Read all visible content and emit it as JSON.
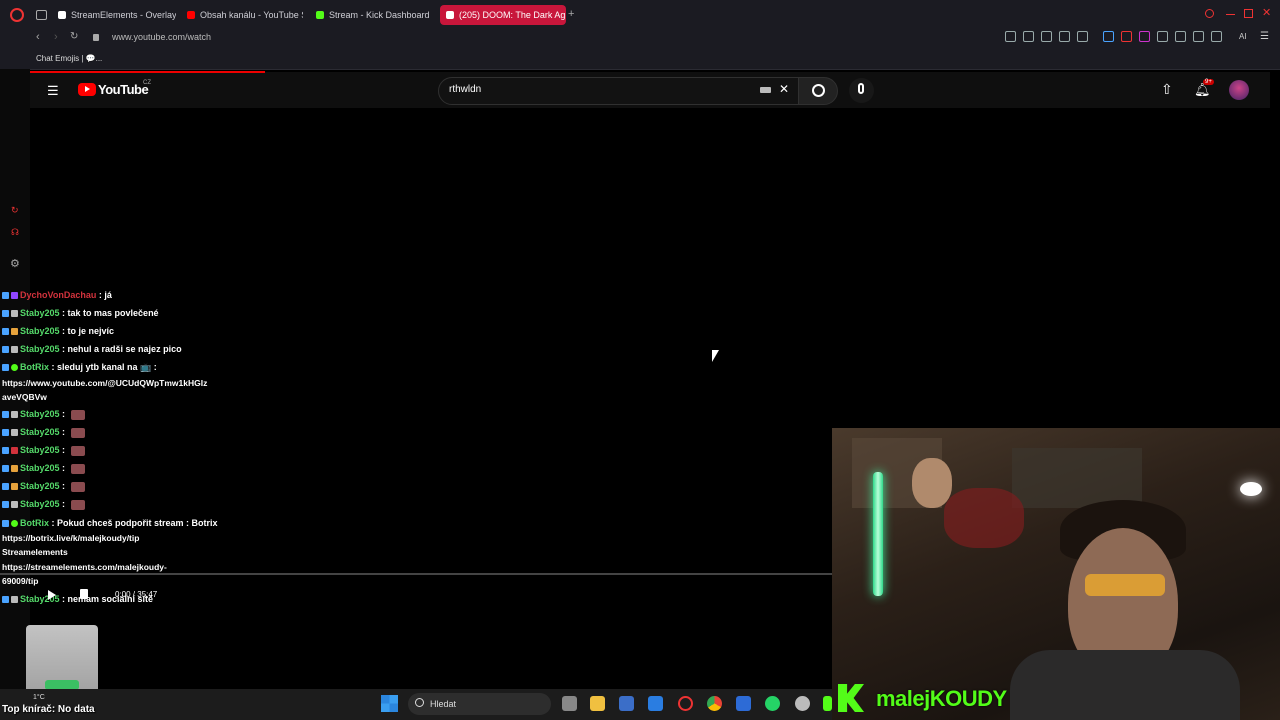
{
  "browser": {
    "tabs": [
      {
        "label": "StreamElements - Overlay",
        "color": "#ffffff"
      },
      {
        "label": "Obsah kanálu - YouTube S",
        "color": "#ff0000"
      },
      {
        "label": "Stream - Kick Dashboard",
        "color": "#53fc18"
      },
      {
        "label": "(205) DOOM: The Dark Ag",
        "color": "#ff0000"
      }
    ],
    "url": "www.youtube.com/watch",
    "bookmark": "Chat Emojis | 💬...",
    "ai_label": "AI"
  },
  "youtube": {
    "logo": "YouTube",
    "region": "CZ",
    "search_query": "rthwldn",
    "notification_count": "9+"
  },
  "chat": [
    {
      "user": "DychoVonDachau",
      "message": " : já",
      "color": "#d2323c"
    },
    {
      "user": "Staby205",
      "message": " : tak to mas povlečené",
      "color": "#55d96a"
    },
    {
      "user": "Staby205",
      "message": " : to je nejvíc",
      "color": "#55d96a"
    },
    {
      "user": "Staby205",
      "message": " : nehul a radši se najez pico",
      "color": "#55d96a"
    },
    {
      "user": "BotRix",
      "message": " : sleduj ytb kanal na 📺 :",
      "color": "#55d96a"
    }
  ],
  "chat_links": [
    "https://www.youtube.com/@UCUdQWpTmw1kHGIz",
    "aveVQBVw"
  ],
  "chat_emote_lines": [
    "Staby205",
    "Staby205",
    "Staby205",
    "Staby205",
    "Staby205",
    "Staby205"
  ],
  "chat_emote_sep": " : ",
  "botrix_support": {
    "user": "BotRix",
    "message": " : Pokud chceš podpořit stream : Botrix"
  },
  "support_links": [
    "https://botrix.live/k/malejkoudy/tip",
    "Streamelements",
    "https://streamelements.com/malejkoudy-",
    "69009/tip"
  ],
  "last_chat": {
    "user": "Staby205",
    "message": " : nemam sociální sítě"
  },
  "player": {
    "time": "0:00 / 35:47",
    "progress": 0.0
  },
  "overlay": {
    "top_label": "Top knírač: No data"
  },
  "kick_name": "malejKOUDY",
  "taskbar": {
    "search_label": "Hledat",
    "temp": "1°C"
  }
}
